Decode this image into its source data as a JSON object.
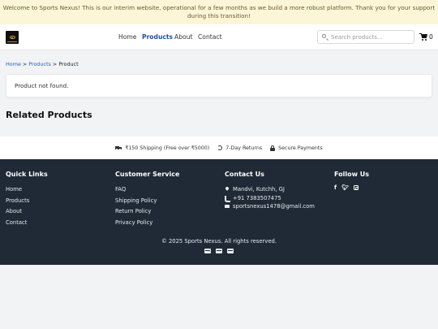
{
  "banner": {
    "text": "Welcome to Sports Nexus! This is our interim website, operational for a few months as we build a more robust platform. Thank you for your support during this transition!"
  },
  "header": {
    "nav": [
      {
        "label": "Home"
      },
      {
        "label": "Products",
        "active": true
      },
      {
        "label": "About"
      },
      {
        "label": "Contact"
      }
    ],
    "search_placeholder": "Search products...",
    "cart_count": "0"
  },
  "breadcrumb": {
    "home": "Home",
    "sep1": " > ",
    "products": "Products",
    "sep2": " > ",
    "current": "Product"
  },
  "main": {
    "message": "Product not found.",
    "related_heading": "Related Products"
  },
  "features": [
    {
      "label": "₹150 Shipping (Free over ₹5000)",
      "icon": "truck-icon"
    },
    {
      "label": "7-Day Returns",
      "icon": "return-icon"
    },
    {
      "label": "Secure Payments",
      "icon": "lock-icon"
    }
  ],
  "footer": {
    "quick_links": {
      "heading": "Quick Links",
      "items": [
        "Home",
        "Products",
        "About",
        "Contact"
      ]
    },
    "customer_service": {
      "heading": "Customer Service",
      "items": [
        "FAQ",
        "Shipping Policy",
        "Return Policy",
        "Privacy Policy"
      ]
    },
    "contact": {
      "heading": "Contact Us",
      "address": "Mandvi, Kutchh, GJ",
      "phone": "+91 7383507475",
      "email": "sportsnexus1478@gmail.com"
    },
    "follow": {
      "heading": "Follow Us",
      "icons": [
        "facebook-icon",
        "twitter-icon",
        "instagram-icon"
      ]
    },
    "copyright": "© 2025 Sports Nexus. All rights reserved.",
    "payment_icons": [
      "card-icon",
      "card-icon",
      "card-icon"
    ]
  },
  "colors": {
    "banner_bg": "#fdf5d8",
    "accent": "#1f4fa8",
    "footer_bg": "#1f2a36"
  }
}
